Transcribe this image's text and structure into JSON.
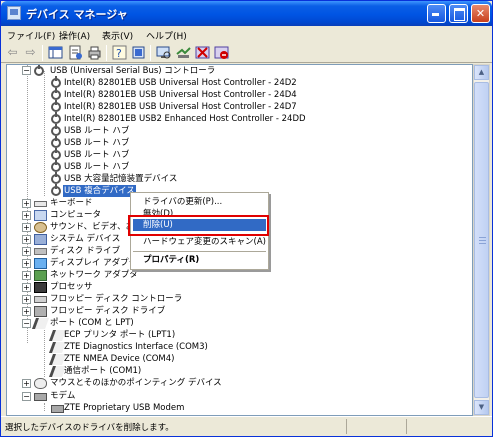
{
  "window": {
    "title": "デバイス マネージャ",
    "buttons": {
      "minimize": "",
      "maximize": "",
      "close": "✕"
    }
  },
  "menubar": [
    {
      "label": "ファイル(F)"
    },
    {
      "label": "操作(A)"
    },
    {
      "label": "表示(V)"
    },
    {
      "label": "ヘルプ(H)"
    }
  ],
  "toolbar": [
    {
      "icon": "back-icon"
    },
    {
      "icon": "forward-icon"
    },
    {
      "icon": "tree-view-icon"
    },
    {
      "icon": "properties-icon"
    },
    {
      "icon": "print-icon"
    },
    {
      "icon": "help-icon"
    },
    {
      "icon": "driver-icon"
    },
    {
      "icon": "scan-icon"
    },
    {
      "icon": "update-driver-icon"
    },
    {
      "icon": "disable-icon"
    },
    {
      "icon": "uninstall-icon"
    }
  ],
  "tree": {
    "usb_group": "USB (Universal Serial Bus) コントローラ",
    "usb_children": [
      "Intel(R) 82801EB USB Universal Host Controller - 24D2",
      "Intel(R) 82801EB USB Universal Host Controller - 24D4",
      "Intel(R) 82801EB USB Universal Host Controller - 24D7",
      "Intel(R) 82801EB USB2 Enhanced Host Controller - 24DD",
      "USB ルート ハブ",
      "USB ルート ハブ",
      "USB ルート ハブ",
      "USB ルート ハブ",
      "USB 大容量記憶装置デバイス",
      "USB 複合デバイス"
    ],
    "groups_a": [
      {
        "label": "キーボード",
        "icon": "keyboard-icon"
      },
      {
        "label": "コンピュータ",
        "icon": "computer-icon"
      },
      {
        "label": "サウンド、ビデオ、およ",
        "icon": "sound-icon"
      },
      {
        "label": "システム デバイス",
        "icon": "system-icon"
      },
      {
        "label": "ディスク ドライブ",
        "icon": "disk-drive-icon"
      },
      {
        "label": "ディスプレイ アダプタ",
        "icon": "display-icon"
      },
      {
        "label": "ネットワーク アダプタ",
        "icon": "network-icon"
      },
      {
        "label": "プロセッサ",
        "icon": "processor-icon"
      },
      {
        "label": "フロッピー ディスク コントローラ",
        "icon": "floppy-controller-icon"
      },
      {
        "label": "フロッピー ディスク ドライブ",
        "icon": "floppy-drive-icon"
      }
    ],
    "ports_group": "ポート (COM と LPT)",
    "ports_children": [
      "ECP プリンタ ポート (LPT1)",
      "ZTE Diagnostics Interface (COM3)",
      "ZTE NMEA Device (COM4)",
      "通信ポート (COM1)"
    ],
    "mouse_group": "マウスとそのほかのポインティング デバイス",
    "modem_group": "モデム",
    "modem_children": [
      "ZTE Proprietary USB Modem"
    ]
  },
  "context_menu": {
    "update_driver": "ドライバの更新(P)...",
    "disable": "無効(D)",
    "uninstall": "削除(U)",
    "scan": "ハードウェア変更のスキャン(A)",
    "properties": "プロパティ(R)"
  },
  "statusbar": {
    "text": "選択したデバイスのドライバを削除します。"
  },
  "colors": {
    "selection": "#316ac5",
    "highlight_box": "#e00000",
    "titlebar": "#0054e3"
  }
}
